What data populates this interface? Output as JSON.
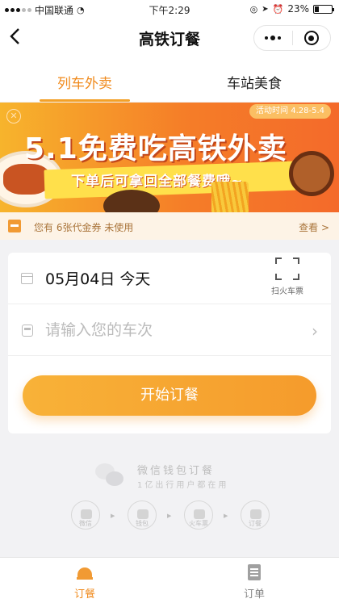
{
  "status_bar": {
    "carrier": "中国联通",
    "time": "下午2:29",
    "battery_percent": "23%",
    "battery_level": 0.23
  },
  "nav": {
    "title": "高铁订餐"
  },
  "tabs": [
    {
      "label": "列车外卖",
      "active": true
    },
    {
      "label": "车站美食",
      "active": false
    }
  ],
  "banner": {
    "headline": "5.1免费吃高铁外卖",
    "subline": "下单后可拿回全部餐费哦~",
    "period": "活动时间 4.28-5.4"
  },
  "coupon": {
    "text": "您有 6张代金券 未使用",
    "action": "查看 >"
  },
  "form": {
    "date": "05月04日 今天",
    "scan_label": "扫火车票",
    "train_placeholder": "请输入您的车次",
    "train_value": "",
    "submit_label": "开始订餐"
  },
  "wechat_info": {
    "title": "微信钱包订餐",
    "subtitle": "1亿出行用户都在用",
    "steps": [
      "微信",
      "钱包",
      "火车票",
      "订餐"
    ]
  },
  "tabbar": [
    {
      "label": "订餐",
      "active": true,
      "icon": "bell-icon"
    },
    {
      "label": "订单",
      "active": false,
      "icon": "list-icon"
    }
  ],
  "colors": {
    "accent": "#f08a1c",
    "button": "#f59b2c"
  }
}
